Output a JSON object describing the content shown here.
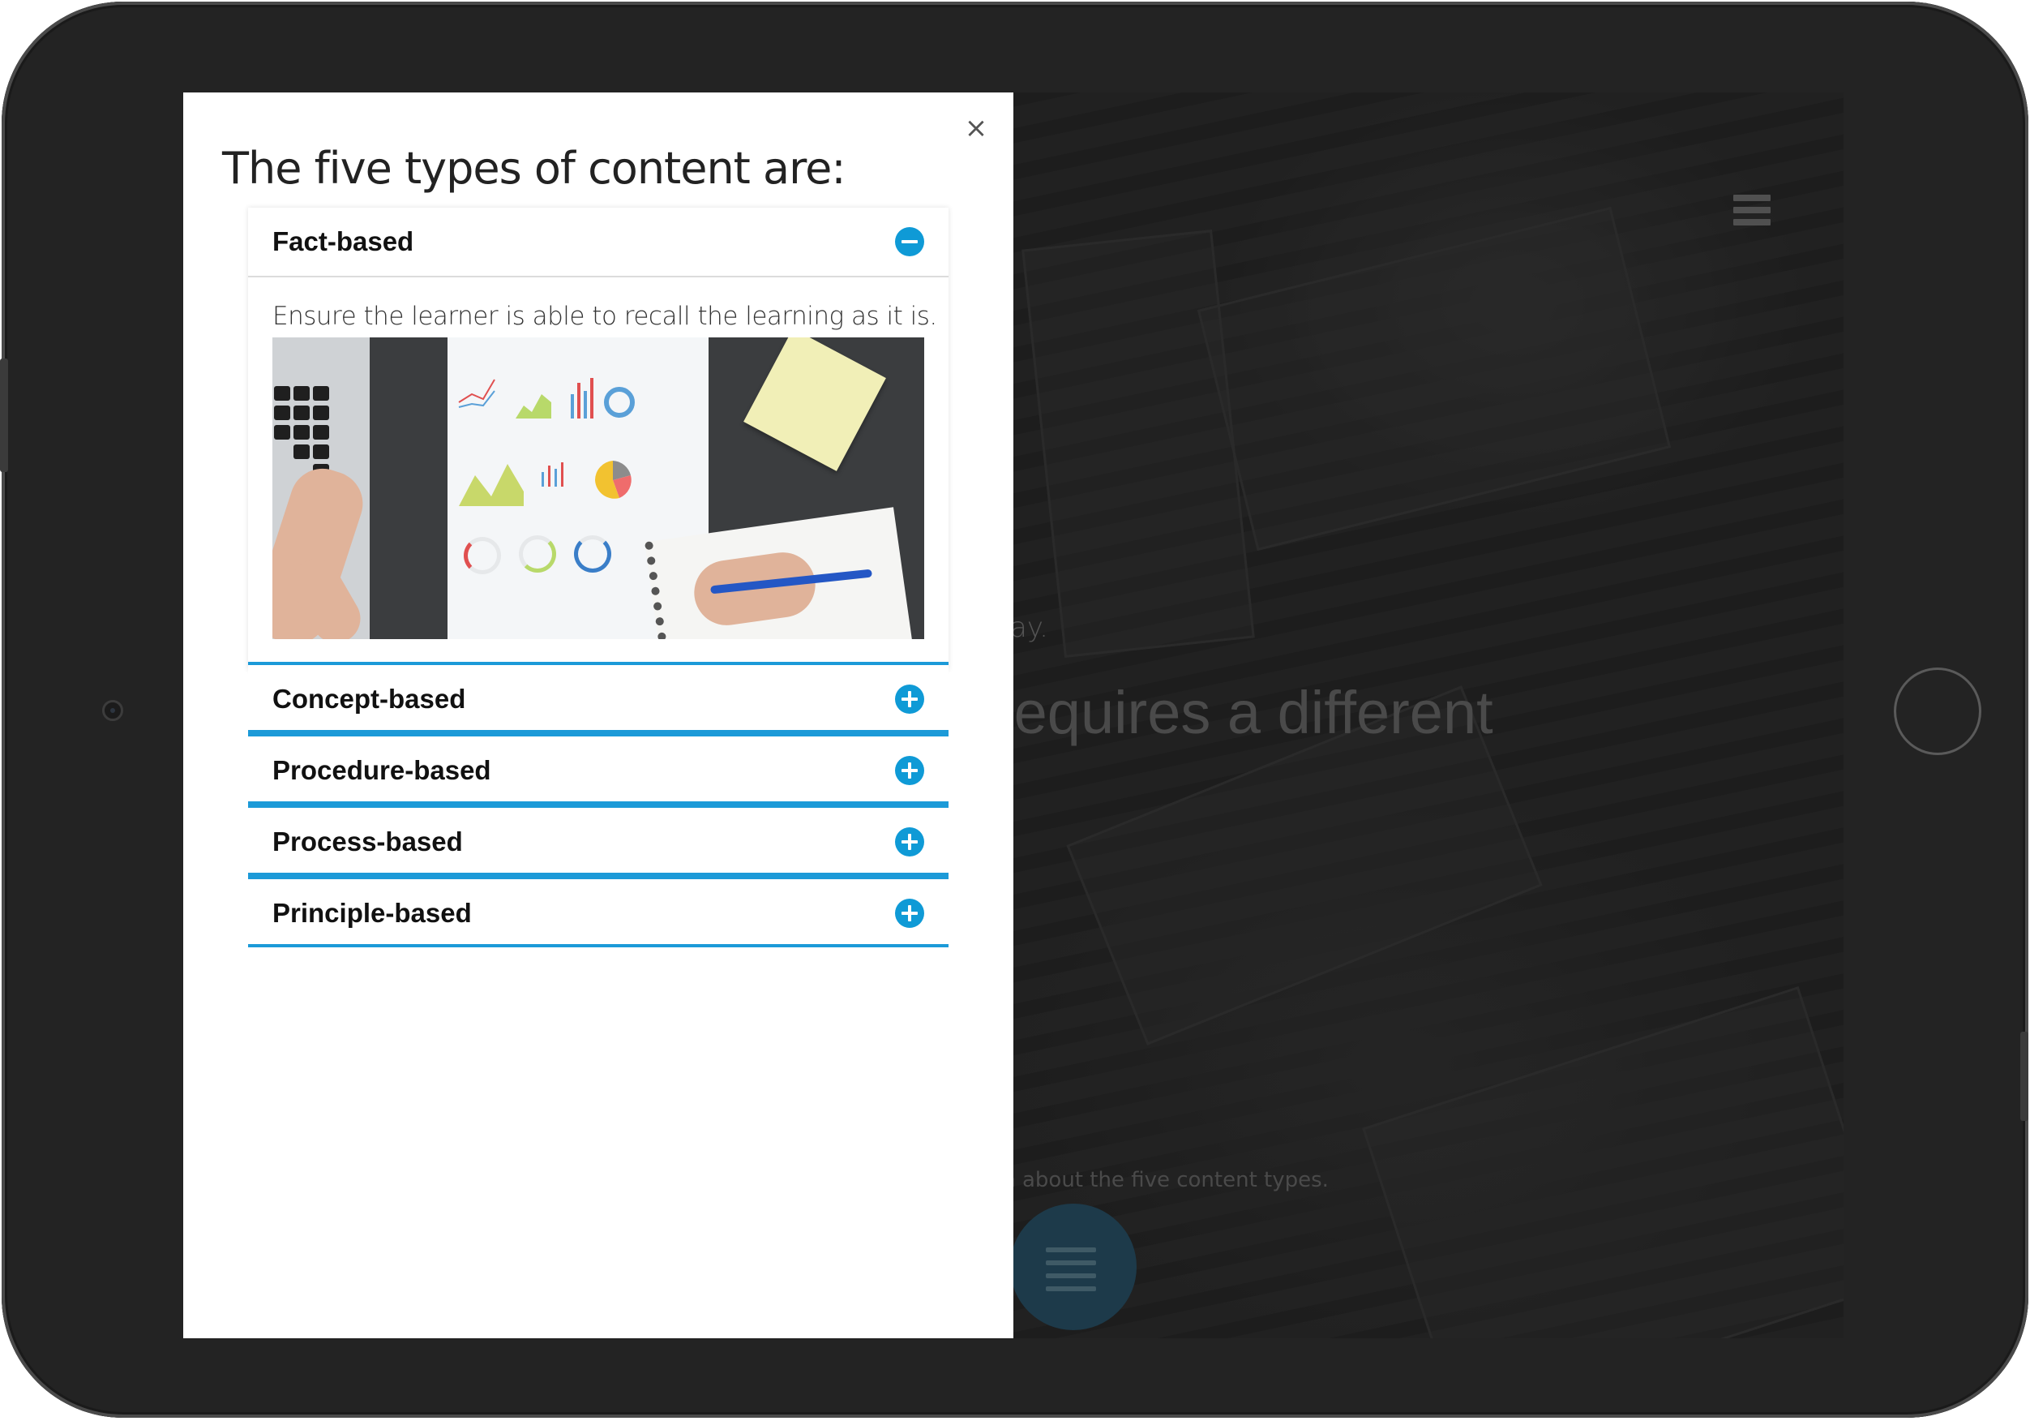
{
  "modal": {
    "close_label": "×",
    "title": "The five types of content are:",
    "items": [
      {
        "label": "Fact-based",
        "expanded": true,
        "body": "Ensure the learner is able to recall the learning as it is."
      },
      {
        "label": "Concept-based",
        "expanded": false
      },
      {
        "label": "Procedure-based",
        "expanded": false
      },
      {
        "label": "Process-based",
        "expanded": false
      },
      {
        "label": "Principle-based",
        "expanded": false
      }
    ]
  },
  "background": {
    "line1": "ay.",
    "line2": "requires a different",
    "line3": "rn about the five content types."
  },
  "colors": {
    "accent": "#1c9ad8",
    "icon": "#0f9ad6",
    "modal_bg": "#ffffff",
    "device_frame": "#232323"
  },
  "icons": {
    "collapse": "minus-circle-icon",
    "expand": "plus-circle-icon",
    "menu": "hamburger-menu-icon",
    "close": "close-icon"
  }
}
